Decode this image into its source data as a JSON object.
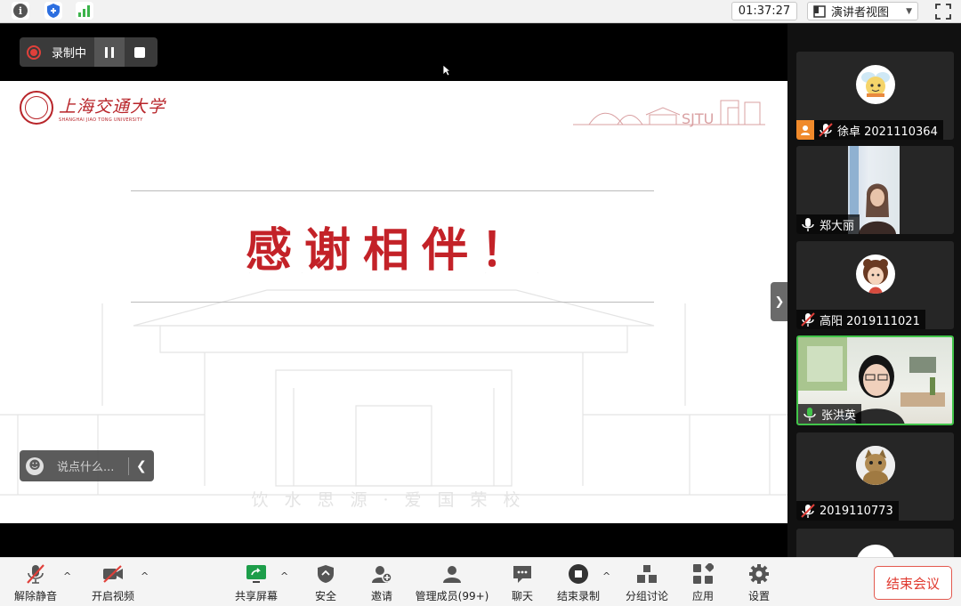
{
  "topbar": {
    "timer": "01:37:27",
    "view_mode": "演讲者视图"
  },
  "recording": {
    "status_label": "录制中"
  },
  "slide": {
    "logo_cn": "上海交通大学",
    "logo_en": "SHANGHAI JIAO TONG UNIVERSITY",
    "brand_art": "SJTU",
    "title": "感谢相伴！",
    "motto": "饮水思源·爱国荣校"
  },
  "chat": {
    "placeholder": "说点什么..."
  },
  "participants": [
    {
      "name": "徐卓 2021110364",
      "mic": "muted",
      "host": true,
      "type": "avatar",
      "avatar": "cartoon-bee"
    },
    {
      "name": "郑大丽",
      "mic": "on",
      "host": false,
      "type": "video"
    },
    {
      "name": "高阳 2019111021",
      "mic": "muted",
      "host": false,
      "type": "avatar",
      "avatar": "cartoon-girl"
    },
    {
      "name": "张洪英",
      "mic": "active",
      "host": false,
      "type": "video",
      "active_speaker": true
    },
    {
      "name": "2019110773",
      "mic": "muted",
      "host": false,
      "type": "avatar",
      "avatar": "cat"
    }
  ],
  "toolbar": {
    "unmute": "解除静音",
    "start_video": "开启视频",
    "share_screen": "共享屏幕",
    "security": "安全",
    "invite": "邀请",
    "manage_members": "管理成员(99+)",
    "chat": "聊天",
    "end_recording": "结束录制",
    "breakout": "分组讨论",
    "apps": "应用",
    "settings": "设置",
    "end_meeting": "结束会议"
  },
  "colors": {
    "accent_red": "#c32228",
    "recording_red": "#e0403a",
    "active_green": "#42c54a",
    "host_orange": "#f08a2b",
    "end_red": "#e03a30"
  }
}
